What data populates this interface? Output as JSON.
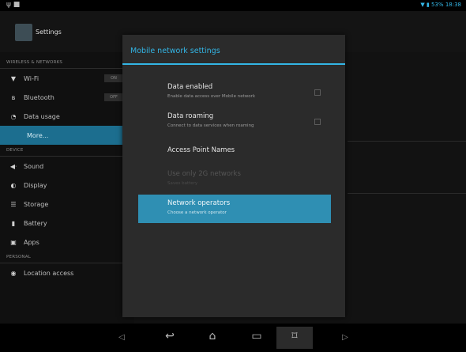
{
  "status": {
    "left_icons": "ψ ■",
    "right": "▼ ▮ 53% 18:38"
  },
  "actionbar": {
    "title": "Settings"
  },
  "sidebar": {
    "sections": [
      "WIRELESS & NETWORKS",
      "DEVICE",
      "PERSONAL"
    ],
    "items": [
      {
        "label": "Wi-Fi",
        "icon": "wifi-icon",
        "glyph": "▼",
        "toggle": "ON"
      },
      {
        "label": "Bluetooth",
        "icon": "bluetooth-icon",
        "glyph": "ʙ",
        "toggle": "OFF"
      },
      {
        "label": "Data usage",
        "icon": "data-usage-icon",
        "glyph": "◔"
      },
      {
        "label": "More..."
      },
      {
        "label": "Sound",
        "icon": "sound-icon",
        "glyph": "◀ᐧ"
      },
      {
        "label": "Display",
        "icon": "display-icon",
        "glyph": "◐"
      },
      {
        "label": "Storage",
        "icon": "storage-icon",
        "glyph": "☰"
      },
      {
        "label": "Battery",
        "icon": "battery-icon",
        "glyph": "▮"
      },
      {
        "label": "Apps",
        "icon": "apps-icon",
        "glyph": "▣"
      },
      {
        "label": "Location access",
        "icon": "location-icon",
        "glyph": "◉"
      }
    ]
  },
  "dialog": {
    "title": "Mobile network settings",
    "options": [
      {
        "title": "Data enabled",
        "summary": "Enable data access over Mobile network",
        "checkbox": true,
        "checked": false
      },
      {
        "title": "Data roaming",
        "summary": "Connect to data services when roaming",
        "checkbox": true,
        "checked": false
      },
      {
        "title": "Access Point Names",
        "summary": ""
      },
      {
        "title": "Use only 2G networks",
        "summary": "Saves battery",
        "disabled": true
      },
      {
        "title": "Network operators",
        "summary": "Choose a network operator",
        "active": true
      }
    ]
  },
  "nav": {
    "vol_down": "◁",
    "back": "↩",
    "home": "⌂",
    "recents": "▭",
    "screenshot": "⌑",
    "vol_up": "▷"
  },
  "colors": {
    "accent": "#33b5e5",
    "selected": "#1c6e8f",
    "highlight": "#2f8fb3",
    "dialog": "#2b2b2b"
  }
}
